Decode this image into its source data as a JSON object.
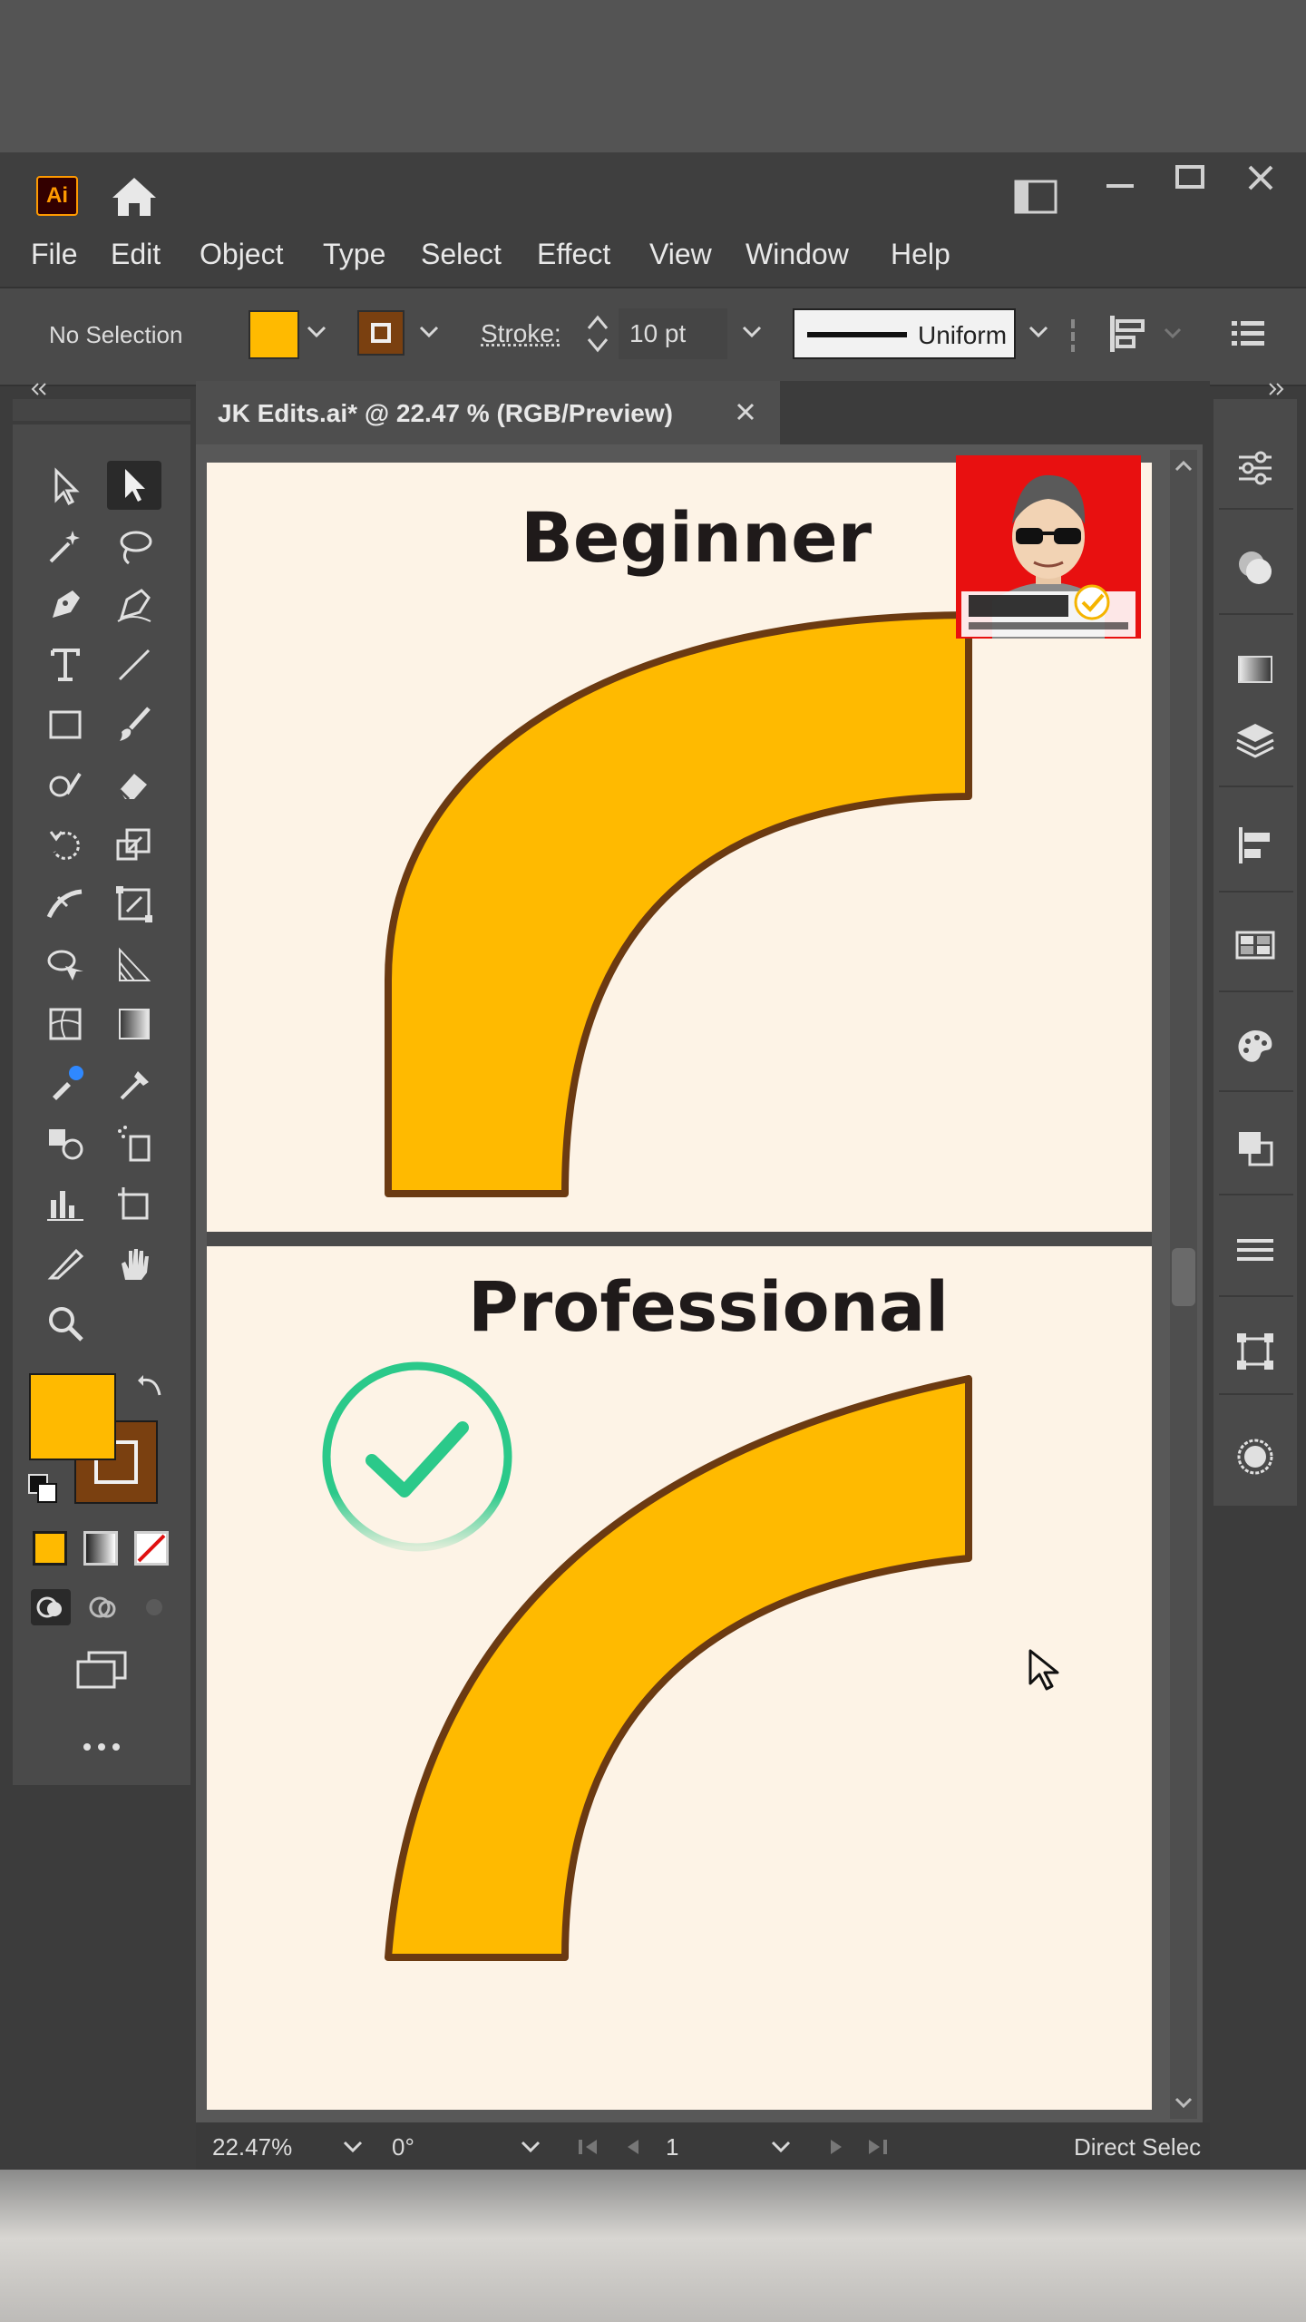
{
  "app": {
    "logo_text": "Ai",
    "menu": [
      "File",
      "Edit",
      "Object",
      "Type",
      "Select",
      "Effect",
      "View",
      "Window",
      "Help"
    ]
  },
  "control_bar": {
    "selection": "No Selection",
    "stroke_label": "Stroke:",
    "stroke_value": "10 pt",
    "profile": "Uniform"
  },
  "document": {
    "tab_title": "JK Edits.ai* @ 22.47 % (RGB/Preview)"
  },
  "artboards": {
    "top_heading": "Beginner",
    "bottom_heading": "Professional"
  },
  "status_bar": {
    "zoom": "22.47%",
    "rotation": "0°",
    "artboard_number": "1",
    "tool_name": "Direct Selec"
  },
  "colors": {
    "shape_fill": "#ffba00",
    "shape_stroke": "#6b3a12",
    "check_ring": "#2bc98a",
    "artboard_bg": "#fdf3e6",
    "avatar_bg": "#e81010"
  },
  "icons": [
    "home-icon",
    "panel-toggle-icon",
    "minimize-icon",
    "maximize-icon",
    "close-icon",
    "direct-selection-icon",
    "checkmark-badge-icon",
    "mouse-cursor-icon"
  ]
}
